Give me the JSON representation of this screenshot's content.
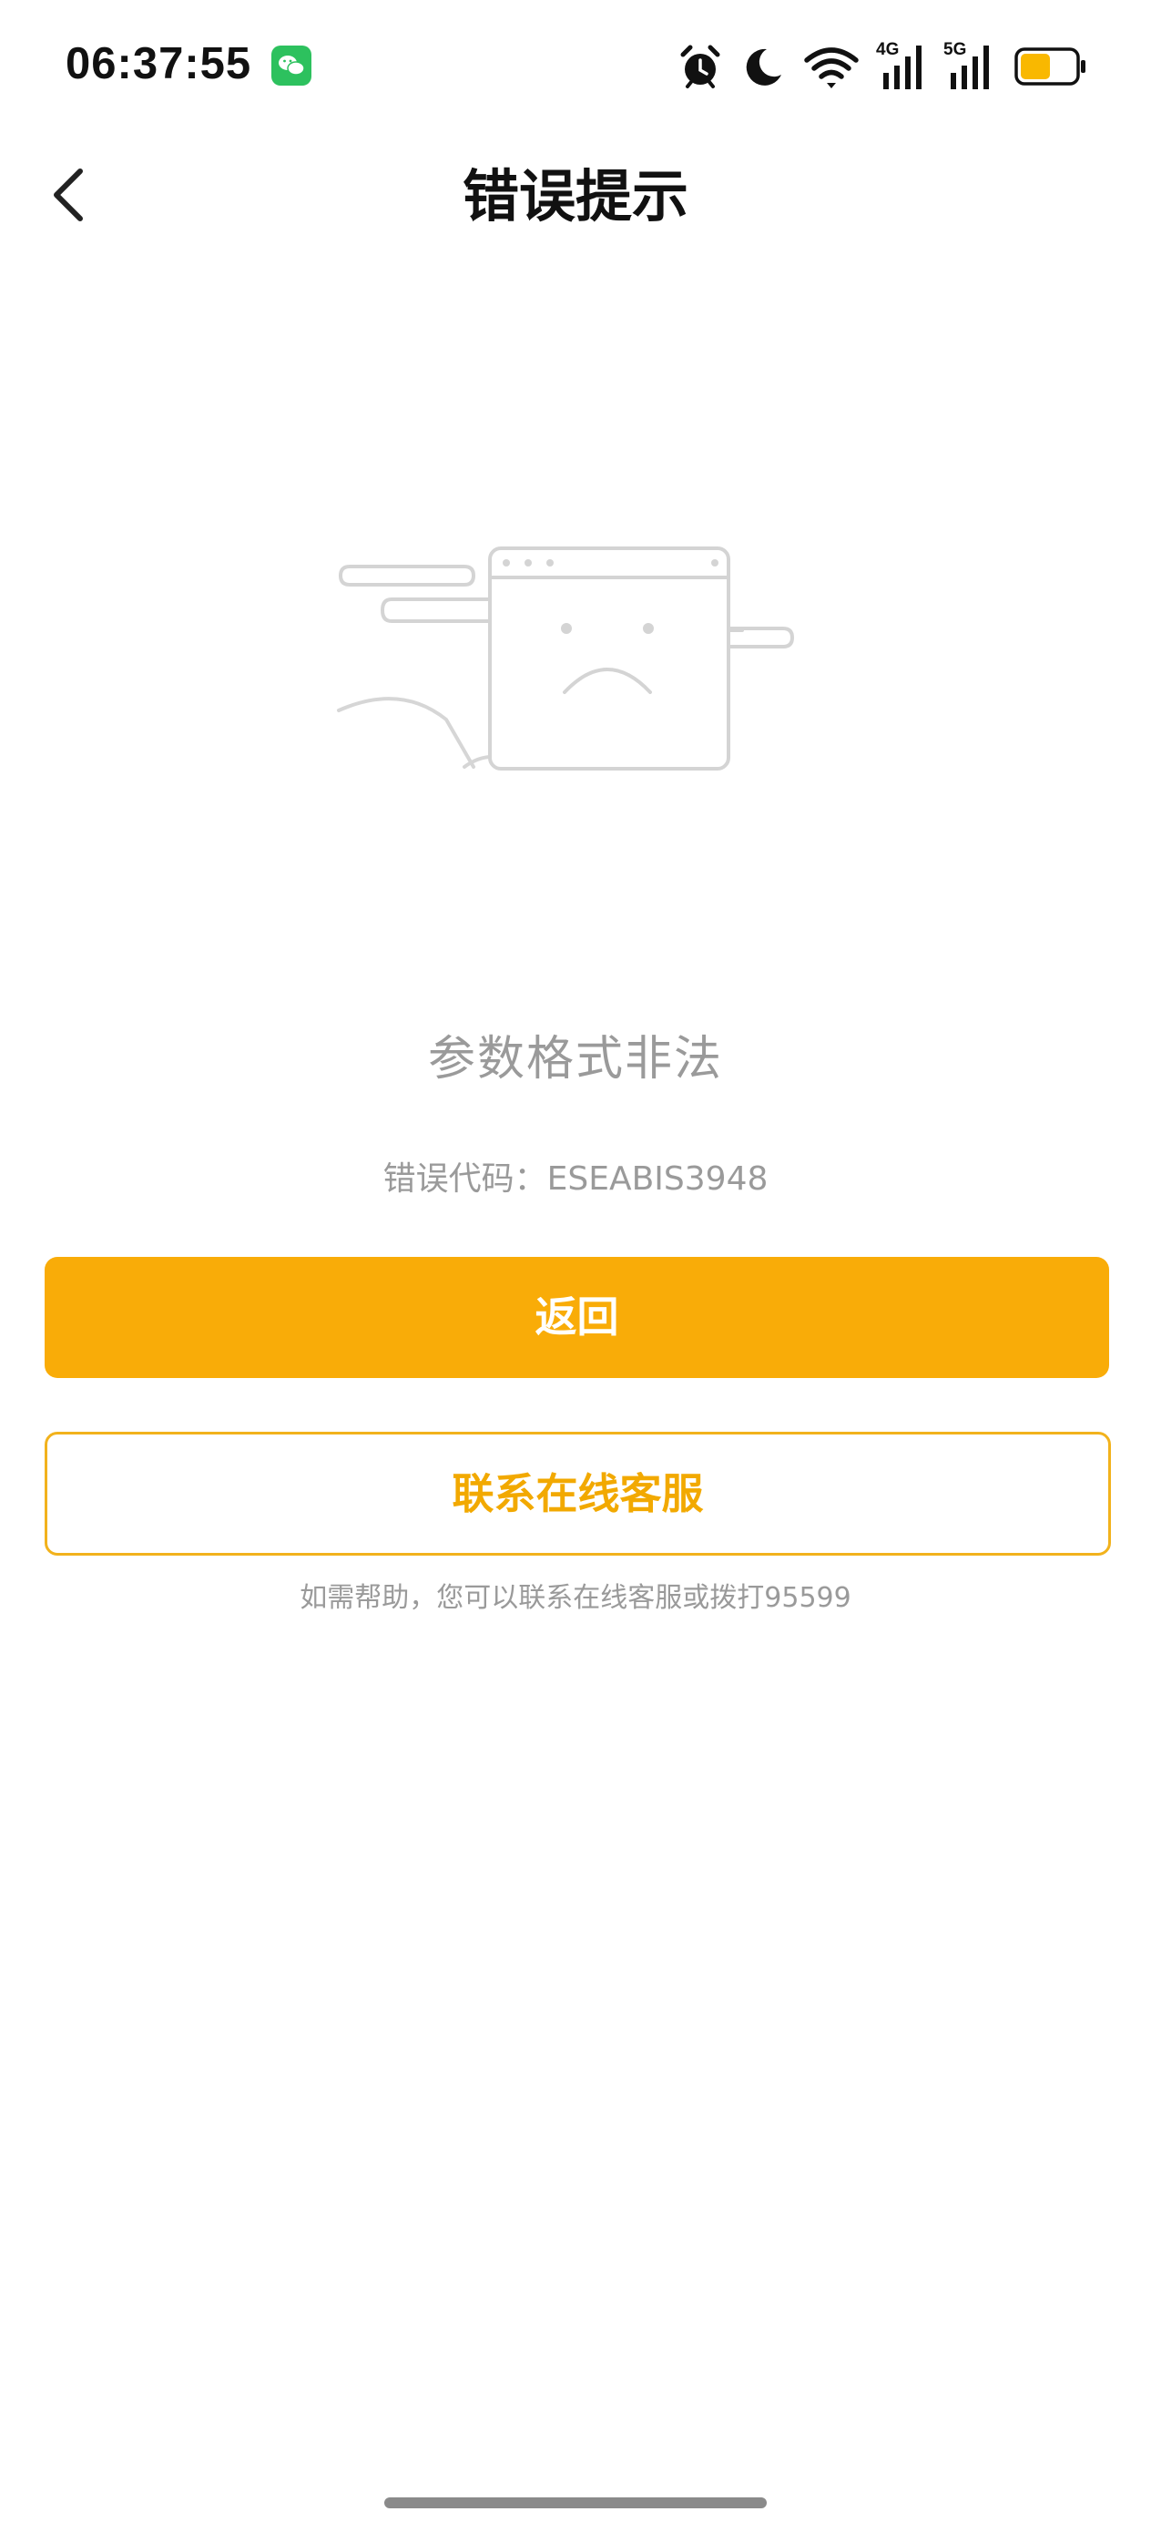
{
  "status_bar": {
    "time": "06:37:55",
    "network_4g": "4G",
    "network_5g": "5G",
    "icons": [
      "wechat-icon",
      "alarm-icon",
      "moon-icon",
      "wifi-icon",
      "signal-4g-icon",
      "signal-5g-icon",
      "battery-icon"
    ],
    "battery_level": 0.55,
    "battery_color": "#F9B800",
    "wechat_color": "#2DC15E"
  },
  "nav": {
    "title": "错误提示",
    "back_icon": "chevron-left-icon"
  },
  "illustration": {
    "icon": "sad-browser-window-icon"
  },
  "error": {
    "message": "参数格式非法",
    "code_label": "错误代码：",
    "code_value": "ESEABIS3948"
  },
  "buttons": {
    "primary_label": "返回",
    "secondary_label": "联系在线客服"
  },
  "help": {
    "text": "如需帮助，您可以联系在线客服或拨打95599"
  },
  "colors": {
    "accent": "#F9AC08",
    "text_muted": "#9a9a9a",
    "title": "#111111"
  }
}
